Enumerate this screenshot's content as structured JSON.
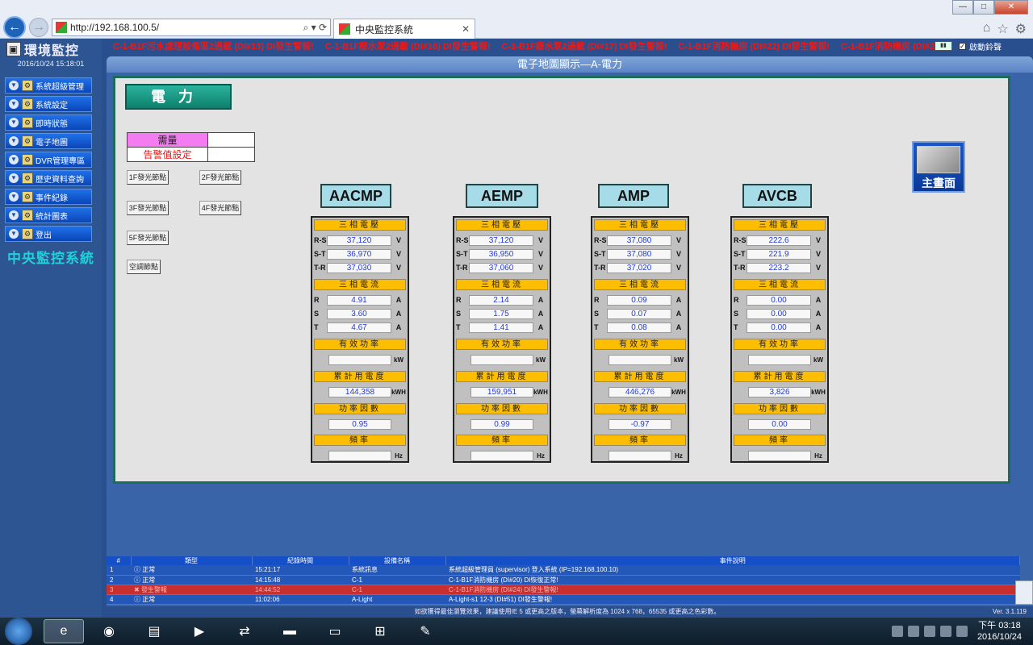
{
  "browser": {
    "url": "http://192.168.100.5/",
    "tab_title": "中央監控系統",
    "controls": "⌕ ▾ ⟳"
  },
  "sidebar": {
    "logo": "環境監控",
    "datetime": "2016/10/24 15:18:01",
    "items": [
      {
        "label": "系統超級管理"
      },
      {
        "label": "系統設定"
      },
      {
        "label": "即時狀態"
      },
      {
        "label": "電子地圖"
      },
      {
        "label": "DVR管理專區"
      },
      {
        "label": "歷史資料查詢"
      },
      {
        "label": "事件紀錄"
      },
      {
        "label": "統計圖表"
      },
      {
        "label": "登出"
      }
    ],
    "brand": "中央監控系統"
  },
  "ticker": [
    "C-1-B1F污水處理設備區2過載 (DI#13) DI發生警報!",
    "C-1-B1F廢水泵2過載 (DI#16) DI發生警報!",
    "C-1-B1F廢水泵2過載 (DI#17) DI發生警報!",
    "C-1-B1F消防機房 (DI#22) DI發生警報!",
    "C-1-B1F消防機房 (DI#24) DI"
  ],
  "sound_label": "啟動鈴聲",
  "panel_title": "電子地圖顯示—A-電力",
  "power_label": "電力",
  "demand": {
    "label": "需量",
    "alarm_label": "告警值設定",
    "value": "",
    "alarm_value": ""
  },
  "shortcut_buttons": [
    "1F發光節點",
    "2F發光節點",
    "3F發光節點",
    "4F發光節點",
    "5F發光節點",
    "空調節點"
  ],
  "home_button": "主畫面",
  "section_labels": {
    "voltage": "三相電壓",
    "current": "三相電流",
    "power": "有效功率",
    "energy": "累計用電度",
    "pf": "功率因數",
    "freq": "頻率"
  },
  "units": {
    "voltage": "V",
    "current": "A",
    "power": "kW",
    "energy": "kWH",
    "freq": "Hz"
  },
  "voltage_labels": [
    "R-S",
    "S-T",
    "T-R"
  ],
  "current_labels": [
    "R",
    "S",
    "T"
  ],
  "meters": [
    {
      "name": "AACMP",
      "voltage": [
        "37,120",
        "36,970",
        "37,030"
      ],
      "current": [
        "4.91",
        "3.60",
        "4.67"
      ],
      "power": "",
      "energy": "144,358",
      "pf": "0.95",
      "freq": ""
    },
    {
      "name": "AEMP",
      "voltage": [
        "37,120",
        "36,950",
        "37,060"
      ],
      "current": [
        "2.14",
        "1.75",
        "1.41"
      ],
      "power": "",
      "energy": "159,951",
      "pf": "0.99",
      "freq": ""
    },
    {
      "name": "AMP",
      "voltage": [
        "37,080",
        "37,080",
        "37,020"
      ],
      "current": [
        "0.09",
        "0.07",
        "0.08"
      ],
      "power": "",
      "energy": "446,276",
      "pf": "-0.97",
      "freq": ""
    },
    {
      "name": "AVCB",
      "voltage": [
        "222.6",
        "221.9",
        "223.2"
      ],
      "current": [
        "0.00",
        "0.00",
        "0.00"
      ],
      "power": "",
      "energy": "3,826",
      "pf": "0.00",
      "freq": ""
    }
  ],
  "log": {
    "headers": [
      "#",
      "類型",
      "紀錄時間",
      "設備名稱",
      "事件說明"
    ],
    "rows": [
      {
        "n": "1",
        "type": "正常",
        "time": "15:21:17",
        "device": "系統訊息",
        "desc": "系統超級管理員 (supervisor) 登入系統 (IP=192.168.100.10)"
      },
      {
        "n": "2",
        "type": "正常",
        "time": "14:15:48",
        "device": "C-1",
        "desc": "C-1-B1F消防機房 (DI#20) DI恢復正常!"
      },
      {
        "n": "3",
        "type": "發生警報",
        "time": "14:44:52",
        "device": "C-1",
        "desc": "C-1-B1F消防機房 (DI#24) DI發生警報!"
      },
      {
        "n": "4",
        "type": "正常",
        "time": "11:02:06",
        "device": "A-Light",
        "desc": "A-Light-s1 12-3 (DI#51) DI發生警報!"
      }
    ]
  },
  "footer": "如欲獲得最佳瀏覽效果，建議使用IE 5 或更高之版本，螢幕解析度為 1024 x 768，65535 或更高之色彩數。",
  "version": "Ver. 3.1.119",
  "clock": {
    "time": "下午 03:18",
    "date": "2016/10/24"
  }
}
